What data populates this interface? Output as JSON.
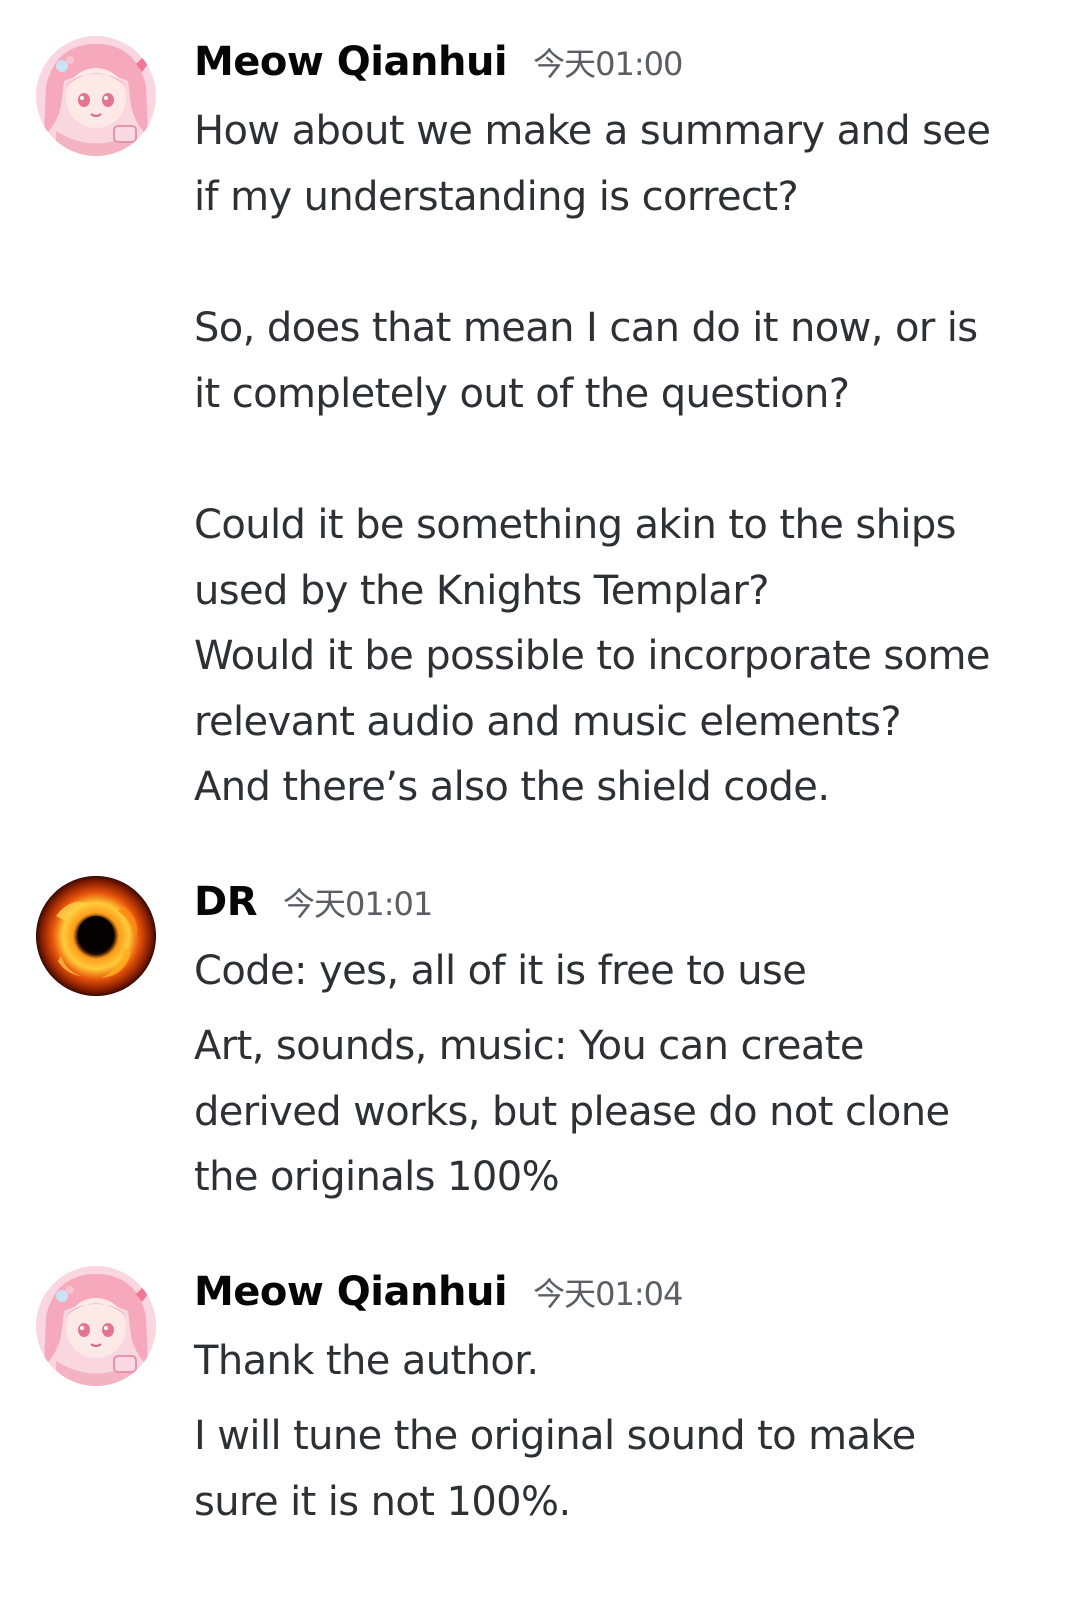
{
  "colors": {
    "background": "#ffffff",
    "author_name": "#060607",
    "timestamp": "#5c5e66",
    "message_text": "#2e3036"
  },
  "messages": [
    {
      "author": "Meow Qianhui",
      "timestamp": "今天01:00",
      "avatar_icon": "pink-anime-girl-avatar",
      "lines": [
        "How about we make a summary and see",
        "if my understanding is correct?",
        "So, does that mean I can do it now, or is",
        "it completely out of the question?",
        "Could it be something akin to the ships",
        "used by the Knights Templar?",
        "Would it be possible to incorporate some",
        "relevant audio and music elements?",
        "And there’s also the shield code."
      ]
    },
    {
      "author": "DR",
      "timestamp": "今天01:01",
      "avatar_icon": "fiery-black-hole-avatar",
      "lines": [
        "Code: yes, all of it is free to use",
        "Art, sounds, music: You can create",
        "derived works, but please do not clone",
        "the originals 100%"
      ]
    },
    {
      "author": "Meow Qianhui",
      "timestamp": "今天01:04",
      "avatar_icon": "pink-anime-girl-avatar",
      "lines": [
        "Thank the author.",
        "I will tune the original sound to make",
        "sure it is not 100%."
      ]
    }
  ]
}
